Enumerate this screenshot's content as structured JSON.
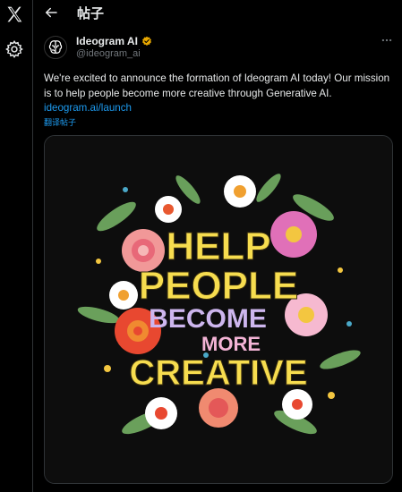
{
  "header": {
    "title": "帖子"
  },
  "author": {
    "name": "Ideogram AI",
    "handle": "@ideogram_ai"
  },
  "post": {
    "text": "We're excited to announce the formation of Ideogram AI today! Our mission is to help people become more creative through Generative AI.",
    "link": "ideogram.ai/launch",
    "translate_label": "翻译帖子"
  },
  "image": {
    "line1": "HELP",
    "line2": "PEOPLE",
    "line3": "BECOME",
    "line4": "MORE",
    "line5": "CREATIVE"
  },
  "icons": {
    "logo": "x-logo-icon",
    "settings": "gear-icon",
    "back": "arrow-left-icon",
    "verified": "verified-badge-icon",
    "more": "more-horizontal-icon"
  },
  "colors": {
    "background": "#000000",
    "text": "#e7e9ea",
    "secondary_text": "#71767b",
    "link": "#1d9bf0",
    "verified_badge": "#e8a800",
    "art_yellow": "#f7dd4f",
    "art_pink": "#f4b4d6",
    "art_lavender": "#cdb6ee"
  }
}
